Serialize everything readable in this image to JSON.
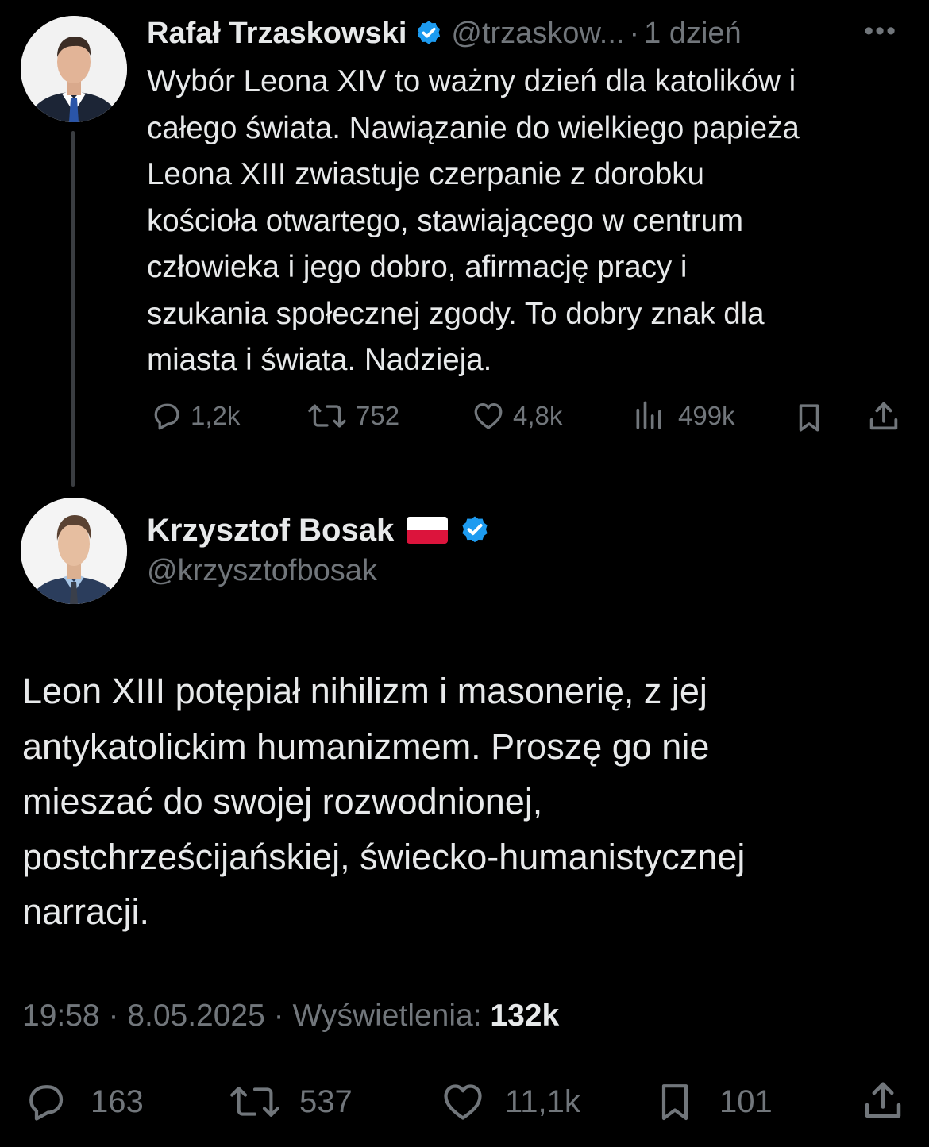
{
  "parent_tweet": {
    "author_name": "Rafał Trzaskowski",
    "handle": "@trzaskow...",
    "separator": "·",
    "time_ago": "1 dzień",
    "more_label": "•••",
    "text": "Wybór Leona XIV to ważny dzień dla katolików i\ncałego świata. Nawiązanie do wielkiego papieża\nLeona XIII zwiastuje czerpanie z dorobku\nkościoła otwartego, stawiającego w centrum\nczłowieka i jego dobro, afirmację pracy i\nszukania społecznej zgody. To dobry znak dla\nmiasta i świata. Nadzieja.",
    "stats": {
      "replies": "1,2k",
      "reposts": "752",
      "likes": "4,8k",
      "views": "499k"
    },
    "icons": [
      "reply-icon",
      "repost-icon",
      "like-icon",
      "views-icon",
      "bookmark-icon",
      "share-icon"
    ]
  },
  "main_tweet": {
    "author_name": "Krzysztof Bosak",
    "handle": "@krzysztofbosak",
    "text": "Leon XIII potępiał nihilizm i masonerię, z jej\nantykatolickim humanizmem. Proszę go nie\nmieszać do swojej rozwodnionej,\npostchrześcijańskiej, świecko-humanistycznej\nnarracji.",
    "time": "19:58",
    "separator": "·",
    "date": "8.05.2025",
    "views_label": "Wyświetlenia:",
    "views_count": "132k",
    "stats": {
      "replies": "163",
      "reposts": "537",
      "likes": "11,1k",
      "bookmarks": "101"
    },
    "icons": [
      "reply-icon",
      "repost-icon",
      "like-icon",
      "bookmark-icon",
      "share-icon"
    ]
  },
  "colors": {
    "background": "#000000",
    "text_primary": "#e7e9ea",
    "text_secondary": "#71767b",
    "verified_blue": "#1d9bf0",
    "thread_line": "#3a3d41",
    "flag_white": "#ffffff",
    "flag_red": "#dc143c"
  }
}
